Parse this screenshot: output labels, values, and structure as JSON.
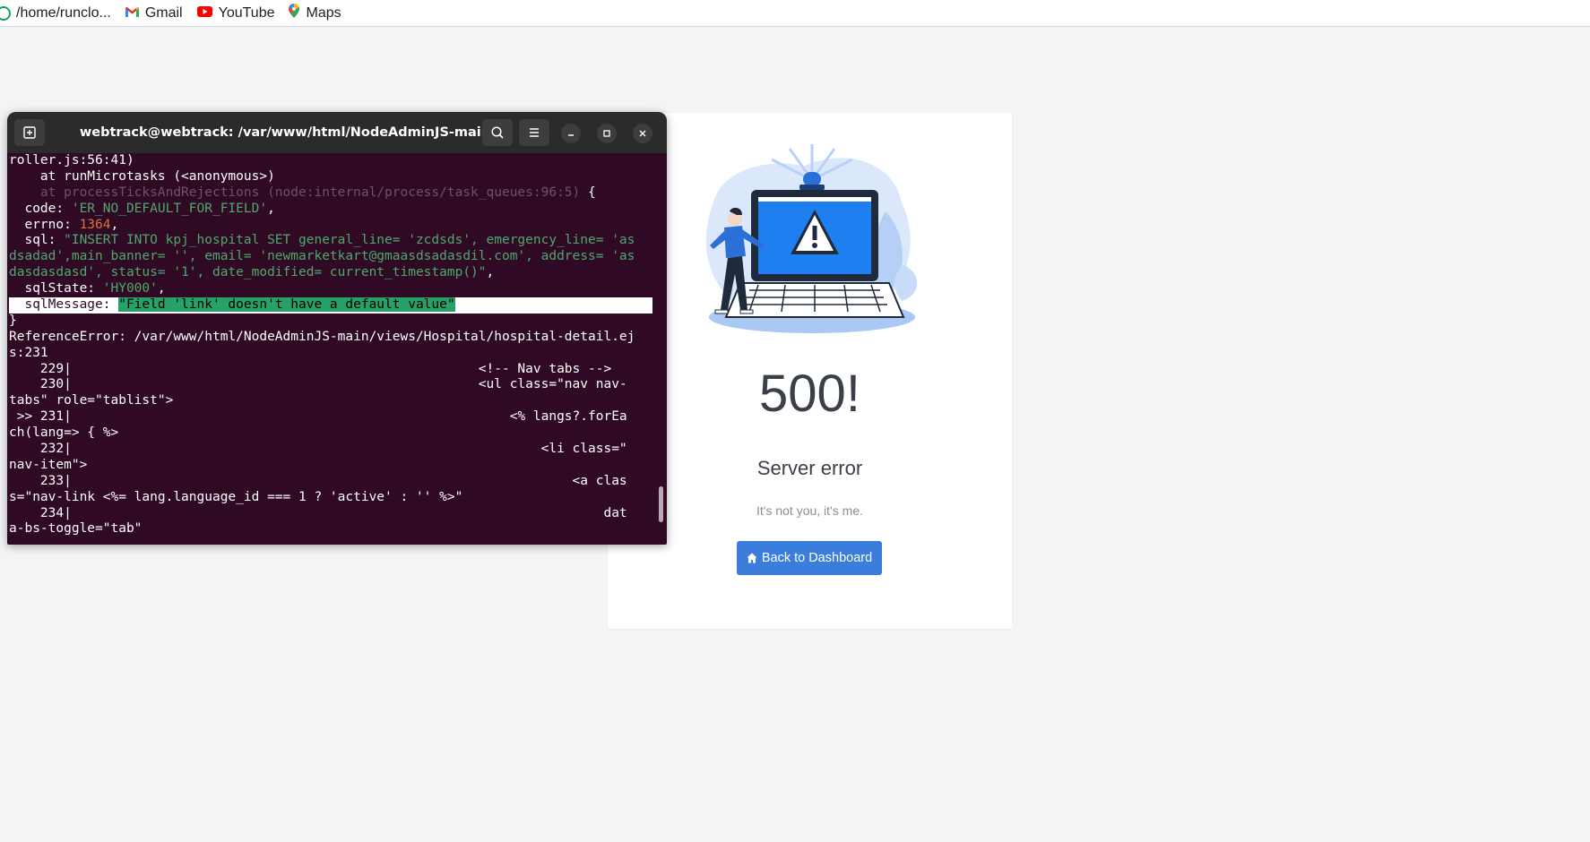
{
  "bookmarks": [
    {
      "label": "/home/runclo...",
      "icon": "folder-icon"
    },
    {
      "label": "Gmail",
      "icon": "gmail-icon"
    },
    {
      "label": "YouTube",
      "icon": "youtube-icon"
    },
    {
      "label": "Maps",
      "icon": "maps-icon"
    }
  ],
  "error_page": {
    "code": "500!",
    "title": "Server error",
    "subtitle": "It's not you, it's me.",
    "button_label": "Back to Dashboard",
    "accent_color": "#3b7ddd"
  },
  "terminal": {
    "title": "webtrack@webtrack: /var/www/html/NodeAdminJS-main",
    "background_color": "#300a24",
    "lines": {
      "l01": "roller.js:56:41)",
      "l02": "    at runMicrotasks (<anonymous>)",
      "l03a": "    at processTicksAndRejections (node:internal/process/task_queues:96:5)",
      "l03b": " {",
      "l04a": "  code: ",
      "l04b": "'ER_NO_DEFAULT_FOR_FIELD'",
      "l04c": ",",
      "l05a": "  errno: ",
      "l05b": "1364",
      "l05c": ",",
      "l06a": "  sql: ",
      "l06b": "\"INSERT INTO kpj_hospital SET general_line= 'zcdsds', emergency_line= 'as",
      "l07": "dsadad',main_banner= '', email= 'newmarketkart@gmaasdsadasdil.com', address= 'as",
      "l08": "dasdasdasd', status= '1', date_modified= current_timestamp()\"",
      "l08c": ",",
      "l09a": "  sqlState: ",
      "l09b": "'HY000'",
      "l09c": ",",
      "l10a": "  sqlMessage: ",
      "l10b": "\"Field 'link' doesn't have a default value\"",
      "l11": "}",
      "l12": "ReferenceError: /var/www/html/NodeAdminJS-main/views/Hospital/hospital-detail.ej",
      "l13": "s:231",
      "l14": "    229|                                                    <!-- Nav tabs -->",
      "l15": "    230|                                                    <ul class=\"nav nav-",
      "l16": "tabs\" role=\"tablist\">",
      "l17": " >> 231|                                                        <% langs?.forEa",
      "l18": "ch(lang=> { %>",
      "l19": "    232|                                                            <li class=\"",
      "l20": "nav-item\">",
      "l21": "    233|                                                                <a clas",
      "l22": "s=\"nav-link <%= lang.language_id === 1 ? 'active' : '' %>\"",
      "l23": "    234|                                                                    dat",
      "l24": "a-bs-toggle=\"tab\""
    }
  }
}
